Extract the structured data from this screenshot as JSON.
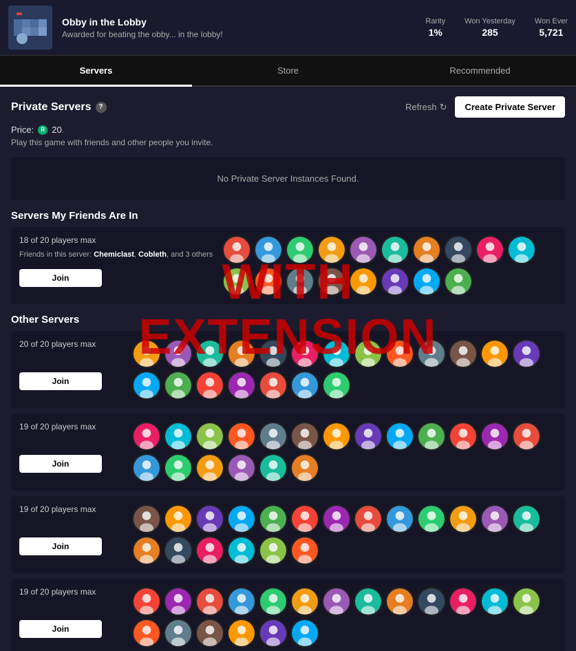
{
  "header": {
    "game_title": "Obby in the Lobby",
    "game_desc": "Awarded for beating the obby... in the lobby!",
    "stats": {
      "rarity_label": "Rarity",
      "rarity_value": "1%",
      "won_yesterday_label": "Won Yesterday",
      "won_yesterday_value": "285",
      "won_ever_label": "Won Ever",
      "won_ever_value": "5,721"
    }
  },
  "nav": {
    "tabs": [
      {
        "id": "servers",
        "label": "Servers",
        "active": true
      },
      {
        "id": "store",
        "label": "Store",
        "active": false
      },
      {
        "id": "recommended",
        "label": "Recommended",
        "active": false
      }
    ]
  },
  "private_servers": {
    "title": "Private Servers",
    "help_char": "?",
    "refresh_label": "Refresh",
    "create_label": "Create Private Server",
    "price_label": "Price:",
    "price_value": "20",
    "description": "Play this game with friends and other people you invite.",
    "no_servers_msg": "No Private Server Instances Found."
  },
  "friends_section": {
    "heading": "Servers My Friends Are In",
    "servers": [
      {
        "player_count": "18 of 20 players max",
        "friends_text": "Friends in this server: Chemiclast, Cobleth, and 3 others",
        "join_label": "Join",
        "avatar_count": 18
      }
    ]
  },
  "other_servers": {
    "heading": "Other Servers",
    "servers": [
      {
        "player_count": "20 of 20 players max",
        "join_label": "Join",
        "avatar_count": 20
      },
      {
        "player_count": "19 of 20 players max",
        "join_label": "Join",
        "avatar_count": 19
      },
      {
        "player_count": "19 of 20 players max",
        "join_label": "Join",
        "avatar_count": 19
      },
      {
        "player_count": "19 of 20 players max",
        "join_label": "Join",
        "avatar_count": 19
      }
    ]
  },
  "watermark": {
    "line1": "WITH",
    "line2": "EXTENSION"
  }
}
